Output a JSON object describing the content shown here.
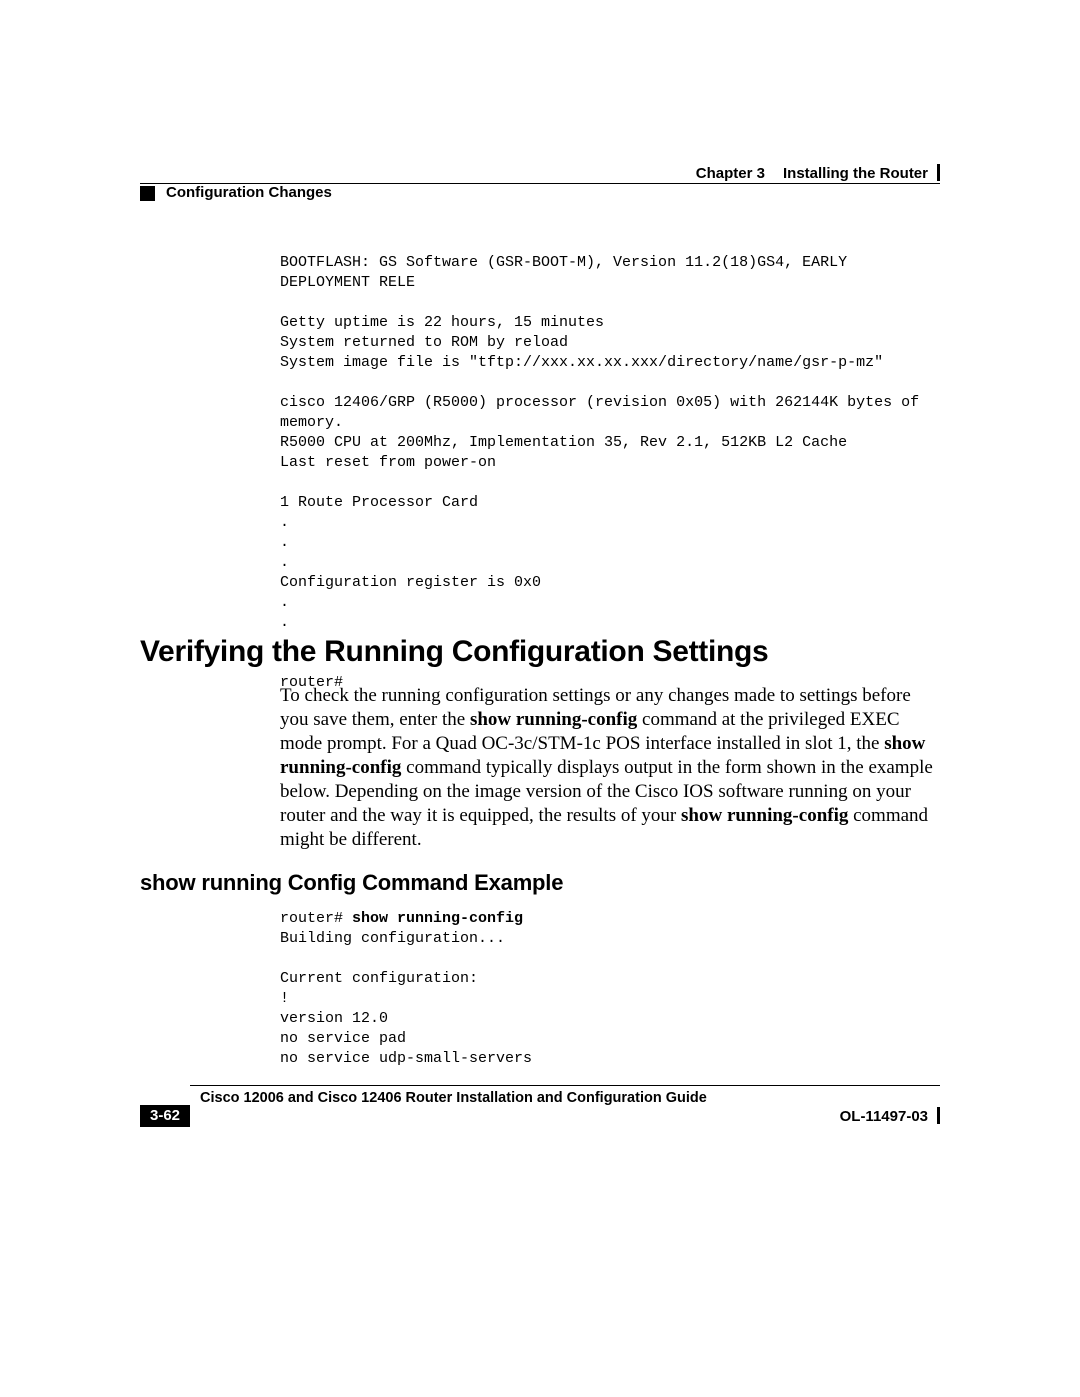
{
  "header": {
    "chapter_label": "Chapter 3",
    "chapter_title": "Installing the Router",
    "section": "Configuration Changes"
  },
  "code1": "BOOTFLASH: GS Software (GSR-BOOT-M), Version 11.2(18)GS4, EARLY DEPLOYMENT RELE\n\nGetty uptime is 22 hours, 15 minutes\nSystem returned to ROM by reload\nSystem image file is \"tftp://xxx.xx.xx.xxx/directory/name/gsr-p-mz\"\n\ncisco 12406/GRP (R5000) processor (revision 0x05) with 262144K bytes of memory.\nR5000 CPU at 200Mhz, Implementation 35, Rev 2.1, 512KB L2 Cache\nLast reset from power-on\n\n1 Route Processor Card\n.\n.\n.\nConfiguration register is 0x0\n.\n.\n.\n\nrouter#",
  "heading1": "Verifying the Running Configuration Settings",
  "para": {
    "t1": "To check the running configuration settings or any changes made to settings before you save them, enter the ",
    "b1": "show running-config",
    "t2": " command at the privileged EXEC mode prompt. For a Quad OC-3c/STM-1c POS interface installed in slot 1, the ",
    "b2": "show running-config",
    "t3": " command typically displays output in the form shown in the example below. Depending on the image version of the Cisco IOS software running on your router and the way it is equipped, the results of your ",
    "b3": "show running-config",
    "t4": " command might be different."
  },
  "heading2": "show running Config Command Example",
  "code2": {
    "prompt": "router# ",
    "cmd": "show running-config",
    "rest": "\nBuilding configuration...\n\nCurrent configuration:\n!\nversion 12.0\nno service pad\nno service udp-small-servers"
  },
  "footer": {
    "book_title": "Cisco 12006 and Cisco 12406 Router Installation and Configuration Guide",
    "page": "3-62",
    "docnum": "OL-11497-03"
  }
}
